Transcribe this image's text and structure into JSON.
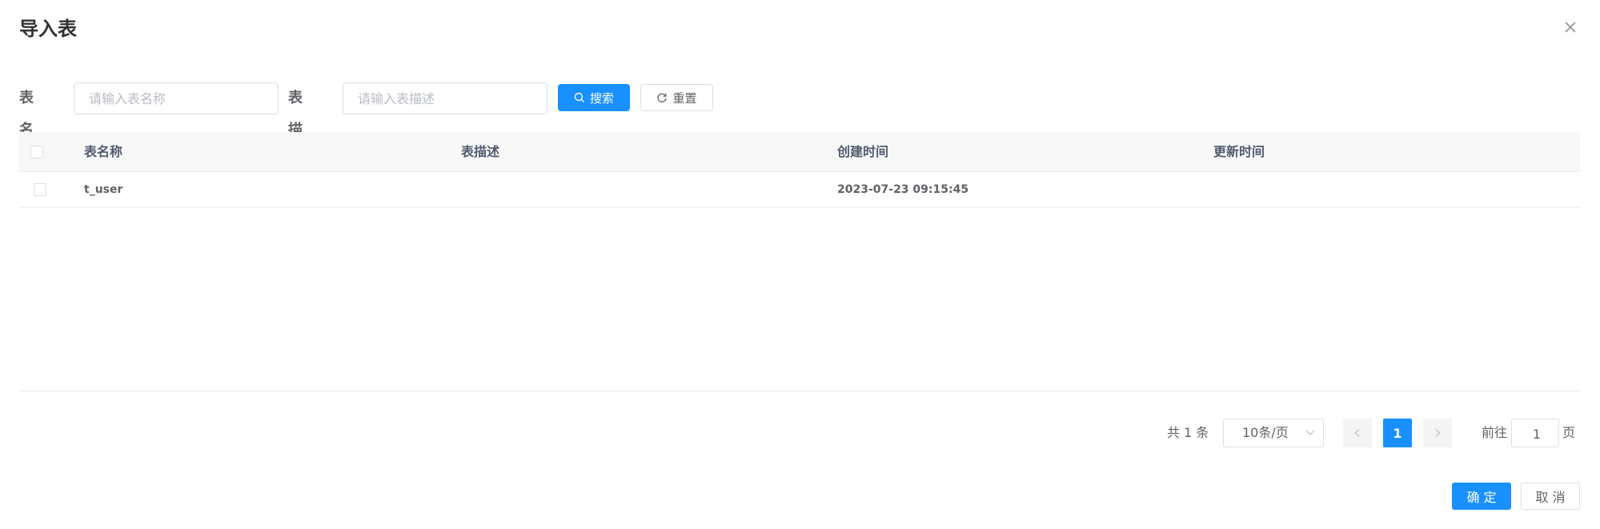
{
  "dialog": {
    "title": "导入表",
    "close_icon": "close-icon"
  },
  "search": {
    "table_name_label": "表名称",
    "table_name_placeholder": "请输入表名称",
    "table_name_value": "",
    "table_desc_label": "表描述",
    "table_desc_placeholder": "请输入表描述",
    "table_desc_value": "",
    "search_button": "搜索",
    "search_icon": "search-icon",
    "reset_button": "重置",
    "reset_icon": "refresh-icon"
  },
  "table": {
    "columns": [
      "表名称",
      "表描述",
      "创建时间",
      "更新时间"
    ],
    "rows": [
      {
        "table_name": "t_user",
        "table_desc": "",
        "create_time": "2023-07-23 09:15:45",
        "update_time": ""
      }
    ]
  },
  "pagination": {
    "total_text": "共 1 条",
    "page_size": "10条/页",
    "current_page": "1",
    "goto_prefix": "前往",
    "goto_value": "1",
    "goto_suffix": "页"
  },
  "footer": {
    "confirm_label": "确 定",
    "cancel_label": "取 消"
  },
  "colors": {
    "primary": "#1890ff",
    "header_bg": "#f8f8f9",
    "border": "#dcdfe6"
  }
}
